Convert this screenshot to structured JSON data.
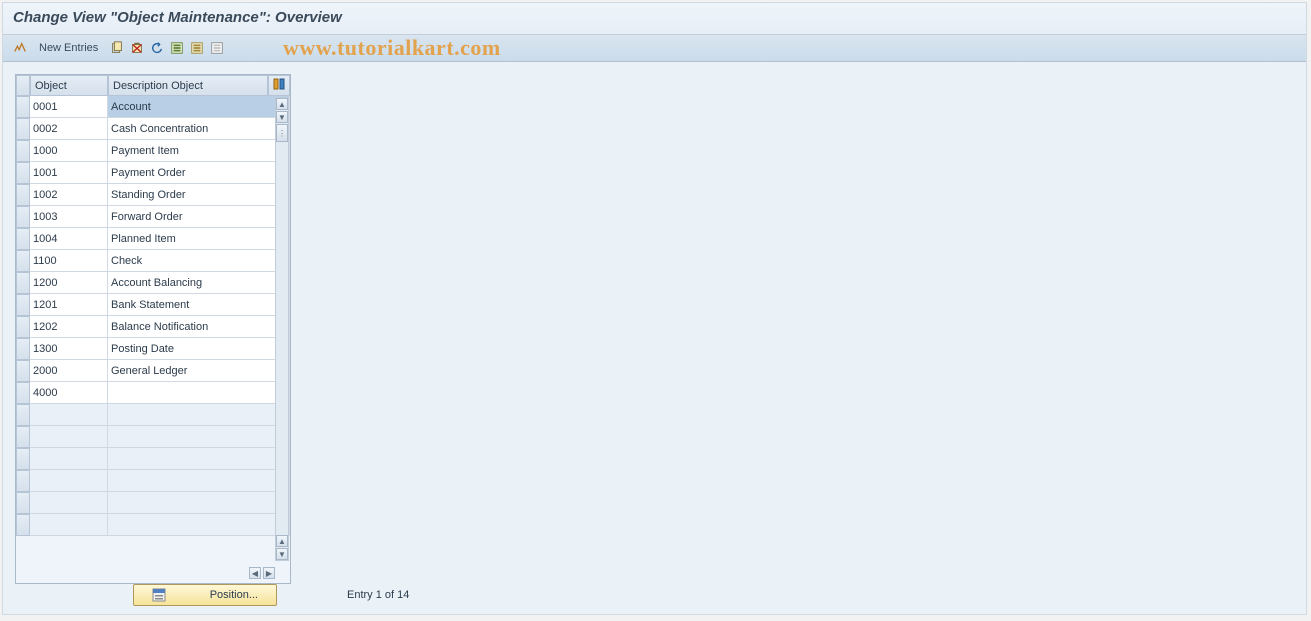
{
  "title": "Change View \"Object Maintenance\": Overview",
  "toolbar": {
    "new_entries_label": "New Entries"
  },
  "watermark": "www.tutorialkart.com",
  "table": {
    "columns": {
      "object": "Object",
      "description": "Description Object"
    },
    "rows": [
      {
        "object": "0001",
        "description": "Account",
        "selected": true
      },
      {
        "object": "0002",
        "description": "Cash Concentration"
      },
      {
        "object": "1000",
        "description": "Payment Item"
      },
      {
        "object": "1001",
        "description": "Payment Order"
      },
      {
        "object": "1002",
        "description": "Standing Order"
      },
      {
        "object": "1003",
        "description": "Forward Order"
      },
      {
        "object": "1004",
        "description": "Planned Item"
      },
      {
        "object": "1100",
        "description": "Check"
      },
      {
        "object": "1200",
        "description": "Account Balancing"
      },
      {
        "object": "1201",
        "description": "Bank Statement"
      },
      {
        "object": "1202",
        "description": "Balance Notification"
      },
      {
        "object": "1300",
        "description": "Posting Date"
      },
      {
        "object": "2000",
        "description": "General Ledger"
      },
      {
        "object": "4000",
        "description": ""
      }
    ],
    "empty_rows": 6
  },
  "footer": {
    "position_label": "Position...",
    "entry_status": "Entry 1 of 14"
  }
}
